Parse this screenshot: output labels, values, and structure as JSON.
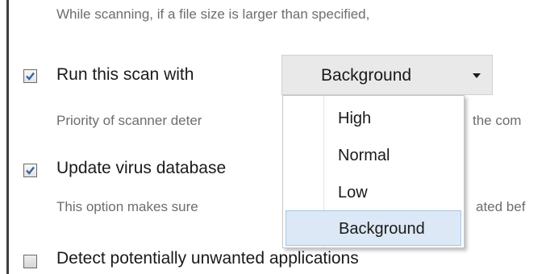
{
  "settings": {
    "size_limit_desc": "While scanning, if a file size is larger than specified,",
    "run_scan": {
      "label": "Run this scan with",
      "checked": true,
      "priority": {
        "selected": "Background",
        "options": [
          "High",
          "Normal",
          "Low",
          "Background"
        ],
        "desc": "Priority of scanner deter",
        "desc_tail": "the com"
      }
    },
    "update_db": {
      "label": "Update virus database",
      "checked": true,
      "desc": "This option makes sure",
      "desc_tail": "ated bef"
    },
    "detect_pua": {
      "label": "Detect potentially unwanted applications",
      "checked": false
    }
  }
}
